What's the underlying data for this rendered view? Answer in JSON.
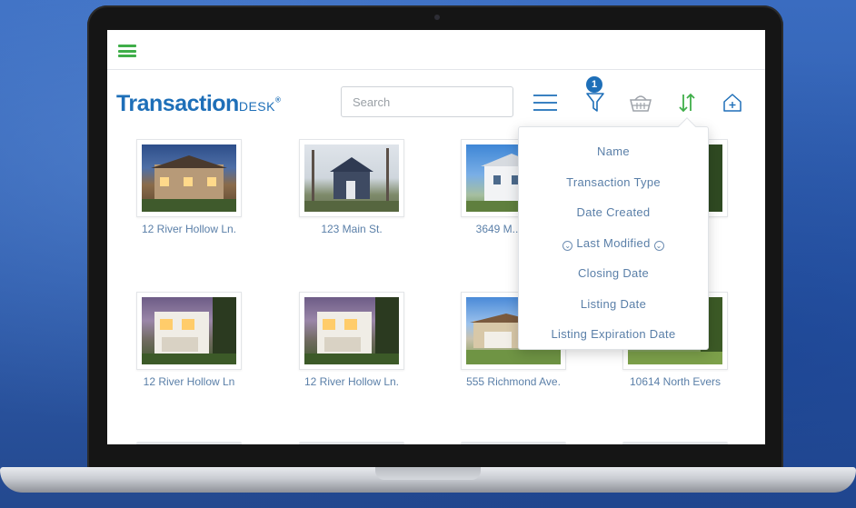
{
  "app": {
    "logo_main": "Transaction",
    "logo_sub": "DESK",
    "logo_tm": "®"
  },
  "search": {
    "placeholder": "Search",
    "value": ""
  },
  "toolbar": {
    "filter_badge": "1",
    "icons": [
      "list-icon",
      "filter-icon",
      "basket-icon",
      "sort-icon",
      "add-home-icon"
    ]
  },
  "sort_menu": {
    "items": [
      "Name",
      "Transaction Type",
      "Date Created",
      "Last Modified",
      "Closing Date",
      "Listing Date",
      "Listing Expiration Date"
    ],
    "active_index": 3
  },
  "transactions": [
    {
      "address": "12 River Hollow Ln."
    },
    {
      "address": "123 Main St."
    },
    {
      "address": "3649 M... Lak..."
    },
    {
      "address": ""
    },
    {
      "address": "12 River Hollow Ln"
    },
    {
      "address": "12 River Hollow Ln."
    },
    {
      "address": "555 Richmond Ave."
    },
    {
      "address": "10614 North Evers"
    }
  ],
  "colors": {
    "brand_blue": "#1e6fb8",
    "accent_green": "#3fae49",
    "link_text": "#5a7fa8"
  }
}
